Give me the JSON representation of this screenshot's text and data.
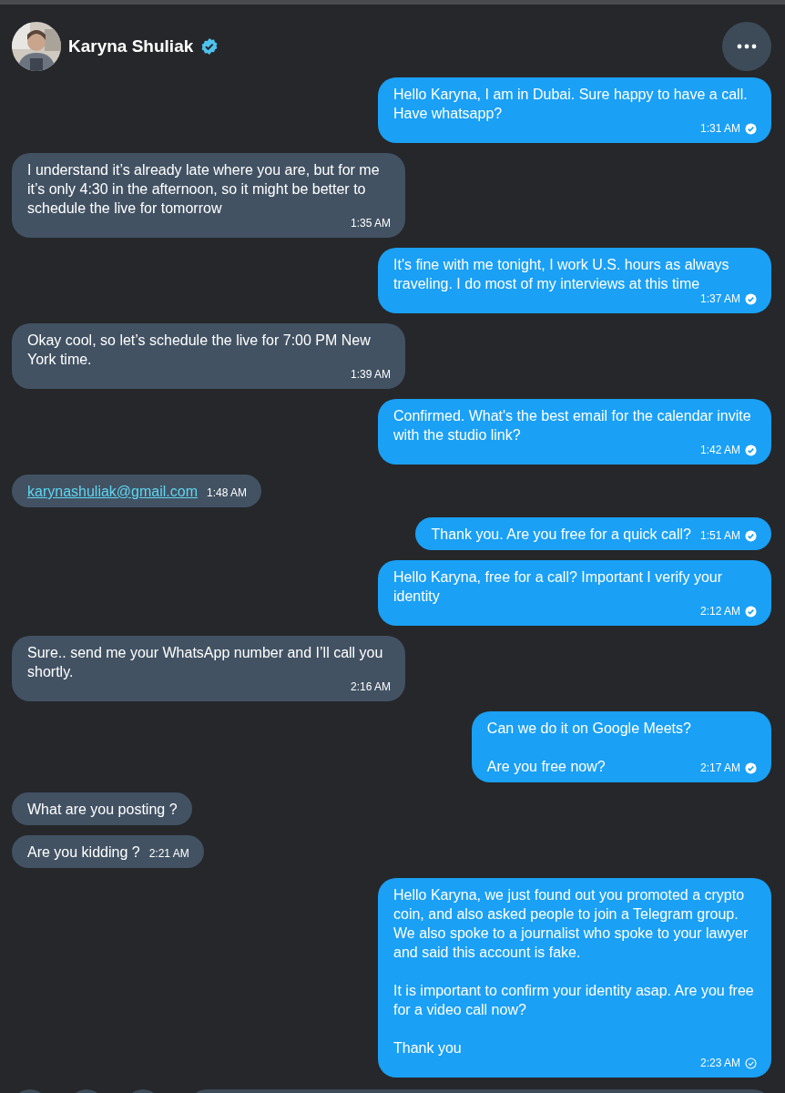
{
  "header": {
    "name": "Karyna Shuliak",
    "verified": true
  },
  "messages": [
    {
      "outgoing": true,
      "kind": "text",
      "text": "Hello Karyna, I am in Dubai. Sure happy to have a call. Have whatsapp?",
      "time": "1:31 AM",
      "read": true
    },
    {
      "outgoing": false,
      "kind": "text",
      "text": "I understand it’s already late where you are, but for me it’s only 4:30 in the afternoon, so it might be better to schedule the live for tomorrow",
      "time": "1:35 AM"
    },
    {
      "outgoing": true,
      "kind": "text",
      "text": "It's fine with me tonight, I work U.S. hours as always traveling. I do most of my interviews at this time",
      "time": "1:37 AM",
      "read": true
    },
    {
      "outgoing": false,
      "kind": "text",
      "text": "Okay cool, so let’s schedule the live for 7:00 PM New York time.",
      "time": "1:39 AM"
    },
    {
      "outgoing": true,
      "kind": "text",
      "text": "Confirmed. What's the best email for the calendar invite with the studio link?",
      "time": "1:42 AM",
      "read": true
    },
    {
      "outgoing": false,
      "kind": "link",
      "text": "karynashuliak@gmail.com",
      "time": "1:48 AM"
    },
    {
      "outgoing": true,
      "kind": "text",
      "text": "Thank you. Are you free for a quick call?",
      "time": "1:51 AM",
      "read": true
    },
    {
      "outgoing": true,
      "kind": "text",
      "text": "Hello Karyna, free for a call? Important I verify your identity",
      "time": "2:12 AM",
      "read": true
    },
    {
      "outgoing": false,
      "kind": "text",
      "text": "Sure.. send me your WhatsApp number and I’ll call you shortly.",
      "time": "2:16 AM"
    },
    {
      "outgoing": true,
      "kind": "text",
      "text": "Can we do it on Google Meets?\n\nAre you free now?",
      "time": "2:17 AM",
      "read": true
    },
    {
      "outgoing": false,
      "kind": "text",
      "text": "What are you posting ?"
    },
    {
      "outgoing": false,
      "kind": "text",
      "text": "Are you kidding ?",
      "time": "2:21 AM"
    },
    {
      "outgoing": true,
      "kind": "text",
      "text": "Hello Karyna, we just found out you promoted a crypto coin, and also asked people to join a Telegram group. We also spoke to a journalist who spoke to your lawyer and said this account is fake.\n\nIt is important to confirm your identity asap. Are you free for a video call now?\n\nThank you",
      "time": "2:23 AM",
      "read": false
    }
  ]
}
